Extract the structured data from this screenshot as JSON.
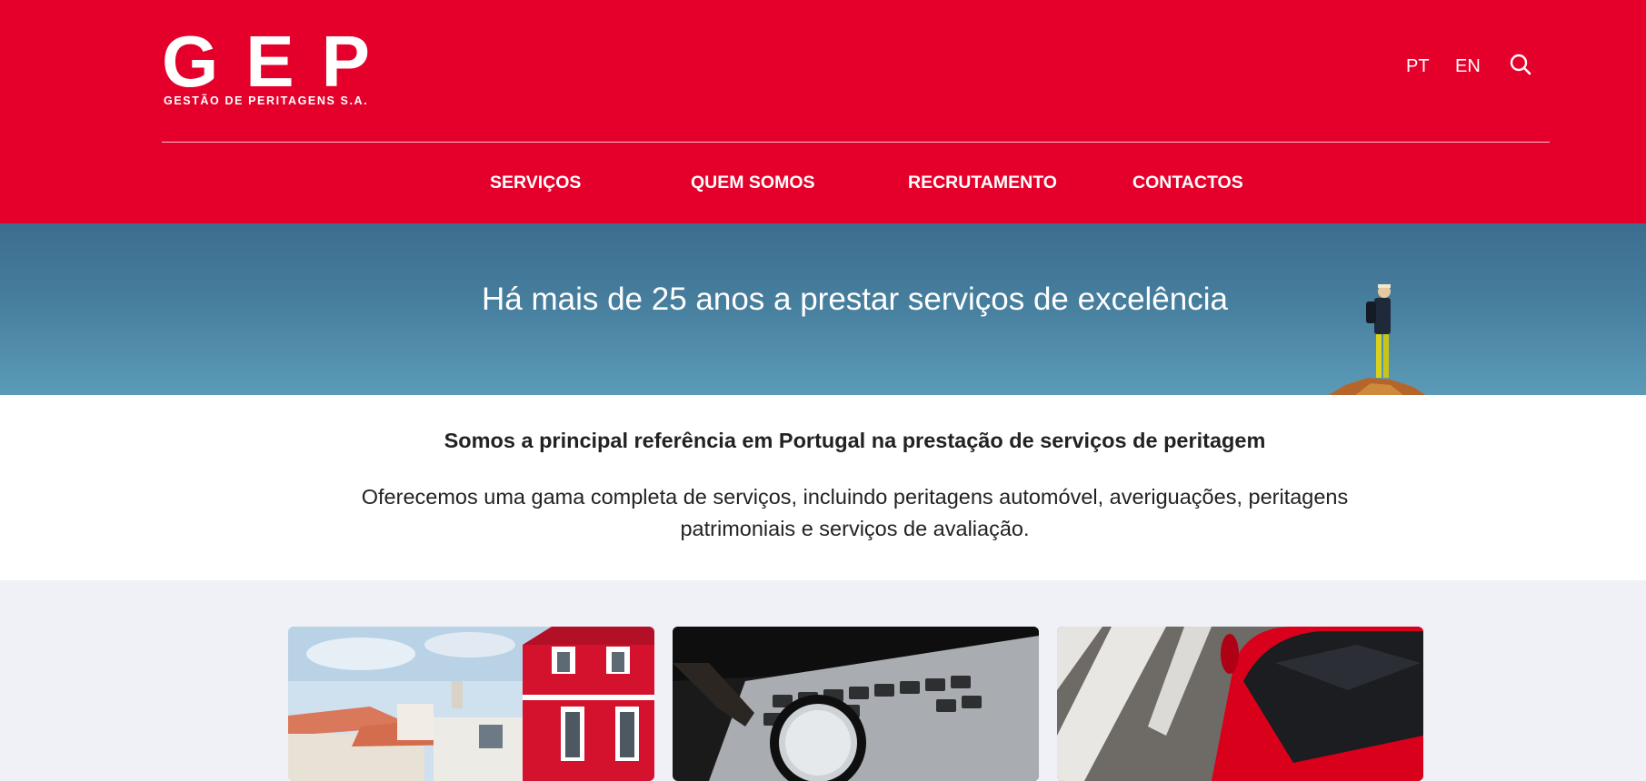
{
  "brand": {
    "logo_letters": [
      "G",
      "E",
      "P"
    ],
    "logo_subtitle": "GESTÃO DE PERITAGENS S.A.",
    "primary_color": "#e4002b"
  },
  "header": {
    "languages": [
      "PT",
      "EN"
    ],
    "search_icon": "search-icon"
  },
  "nav": {
    "items": [
      "SERVIÇOS",
      "QUEM SOMOS",
      "RECRUTAMENTO",
      "CONTACTOS"
    ]
  },
  "hero": {
    "title": "Há mais de 25 anos a prestar serviços de excelência"
  },
  "intro": {
    "heading": "Somos a principal referência em Portugal na prestação de serviços de peritagem",
    "text": "Oferecemos uma gama completa de serviços, incluindo peritagens automóvel, averiguações, peritagens patrimoniais e serviços de avaliação."
  },
  "cards": [
    {
      "image": "red-buildings-photo"
    },
    {
      "image": "magnifying-glass-laptop-photo"
    },
    {
      "image": "red-car-photo"
    }
  ]
}
